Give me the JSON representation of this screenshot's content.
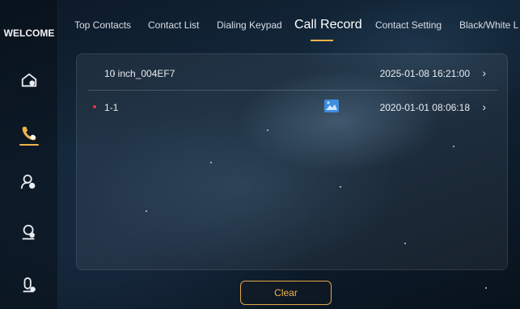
{
  "sidebar": {
    "welcome": "WELCOME",
    "items": [
      {
        "icon": "home-icon"
      },
      {
        "icon": "phone-icon",
        "active": true
      },
      {
        "icon": "user-gear-icon"
      },
      {
        "icon": "user-headset-icon"
      },
      {
        "icon": "intercom-icon"
      }
    ]
  },
  "nav": {
    "tabs": [
      {
        "label": "Top Contacts"
      },
      {
        "label": "Contact List"
      },
      {
        "label": "Dialing Keypad"
      },
      {
        "label": "Call Record",
        "active": true
      },
      {
        "label": "Contact Setting"
      },
      {
        "label": "Black/White L"
      }
    ]
  },
  "records": [
    {
      "name": "10 inch_004EF7",
      "time": "2025-01-08  16:21:00",
      "missed": false,
      "has_image": false
    },
    {
      "name": "1-1",
      "time": "2020-01-01  08:06:18",
      "missed": true,
      "has_image": true
    }
  ],
  "actions": {
    "clear_label": "Clear"
  },
  "colors": {
    "accent": "#f0b44a",
    "missed_dot": "#e2334a",
    "image_icon": "#3d8fe0"
  }
}
